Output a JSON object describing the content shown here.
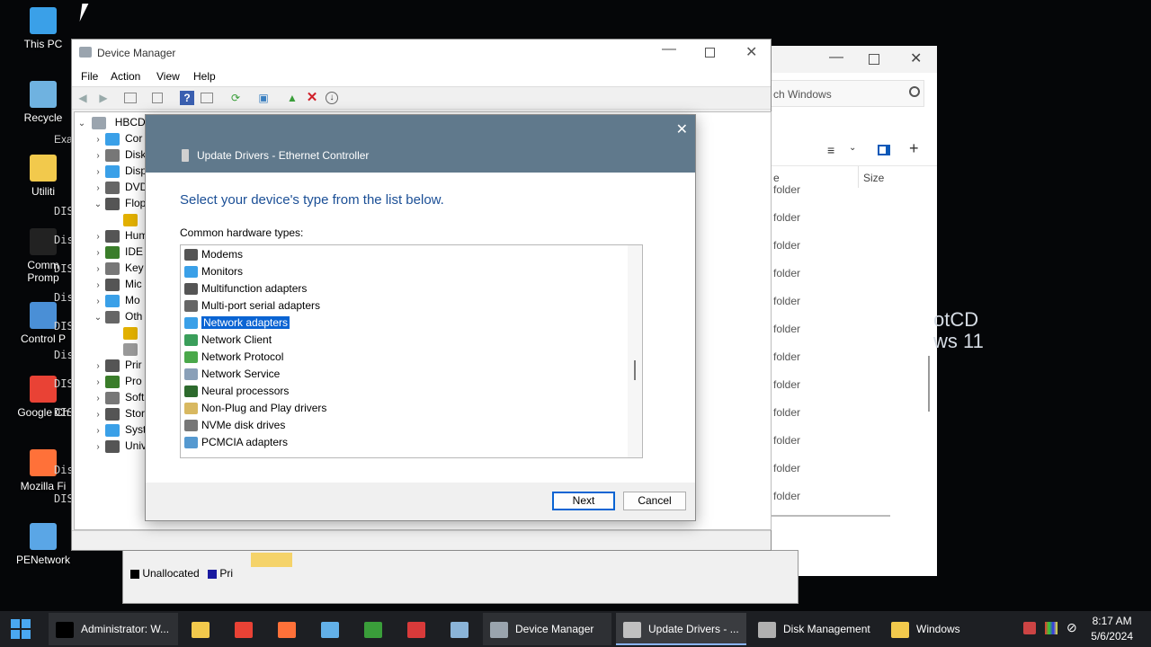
{
  "desktop": {
    "icons": [
      {
        "label": "This PC",
        "name": "this-pc",
        "color": "#3aa0e8"
      },
      {
        "label": "Recycle",
        "name": "recycle-bin",
        "color": "#6fb2e0"
      },
      {
        "label": "Utiliti",
        "name": "utilities",
        "color": "#f2c94c"
      },
      {
        "label": "Comm",
        "label2": "Promp",
        "name": "command-prompt",
        "color": "#222222"
      },
      {
        "label": "Control P",
        "name": "control-panel",
        "color": "#4a8fd6"
      },
      {
        "label": "Google Ch",
        "name": "google-chrome",
        "color": "#e94235"
      },
      {
        "label": "Mozilla Fi",
        "name": "mozilla-firefox",
        "color": "#ff7139"
      },
      {
        "label": "PENetwork",
        "name": "penetwork",
        "color": "#5aa6e6"
      }
    ],
    "partial_text_ex": "Exa",
    "dis_lines": [
      "DIS",
      "Dis",
      "DIS",
      "DIS",
      "Dis",
      "DIS",
      "Dis",
      "DIS",
      "Dis",
      "DIS"
    ],
    "background_text": [
      "otCD",
      "ws 11"
    ]
  },
  "explorer": {
    "search_placeholder": "ch Windows",
    "column_header_left": "e",
    "column_header_size": "Size",
    "rows": [
      "folder",
      "folder",
      "folder",
      "folder",
      "folder",
      "folder",
      "folder",
      "folder",
      "folder",
      "folder",
      "folder",
      "folder"
    ]
  },
  "disk_management": {
    "legend": [
      {
        "label": "Unallocated",
        "color": "#000000"
      },
      {
        "label": "Pri",
        "color": "#1a1aa0"
      }
    ]
  },
  "device_manager": {
    "title": "Device Manager",
    "menu": [
      "File",
      "Action",
      "View",
      "Help"
    ],
    "tree": {
      "root": "HBCD_",
      "items": [
        {
          "label": "Cor",
          "arrow": "›",
          "indent": 1,
          "color": "#3aa0e8"
        },
        {
          "label": "Disk",
          "arrow": "›",
          "indent": 1,
          "color": "#777777"
        },
        {
          "label": "Disp",
          "arrow": "›",
          "indent": 1,
          "color": "#3aa0e8"
        },
        {
          "label": "DVD",
          "arrow": "›",
          "indent": 1,
          "color": "#666666"
        },
        {
          "label": "Flop",
          "arrow": "⌄",
          "indent": 1,
          "color": "#555555"
        },
        {
          "label": "",
          "arrow": "",
          "indent": 2,
          "color": "#e2b000"
        },
        {
          "label": "Hum",
          "arrow": "›",
          "indent": 1,
          "color": "#555555"
        },
        {
          "label": "IDE",
          "arrow": "›",
          "indent": 1,
          "color": "#3a7d2a"
        },
        {
          "label": "Key",
          "arrow": "›",
          "indent": 1,
          "color": "#777777"
        },
        {
          "label": "Mic",
          "arrow": "›",
          "indent": 1,
          "color": "#555555"
        },
        {
          "label": "Mo",
          "arrow": "›",
          "indent": 1,
          "color": "#3aa0e8"
        },
        {
          "label": "Oth",
          "arrow": "⌄",
          "indent": 1,
          "color": "#666666"
        },
        {
          "label": "",
          "arrow": "",
          "indent": 2,
          "color": "#e2b000"
        },
        {
          "label": "",
          "arrow": "",
          "indent": 2,
          "color": "#999999"
        },
        {
          "label": "Prir",
          "arrow": "›",
          "indent": 1,
          "color": "#555555"
        },
        {
          "label": "Pro",
          "arrow": "›",
          "indent": 1,
          "color": "#3a7d2a"
        },
        {
          "label": "Soft",
          "arrow": "›",
          "indent": 1,
          "color": "#777777"
        },
        {
          "label": "Stor",
          "arrow": "›",
          "indent": 1,
          "color": "#555555"
        },
        {
          "label": "Syst",
          "arrow": "›",
          "indent": 1,
          "color": "#3aa0e8"
        },
        {
          "label": "Univ",
          "arrow": "›",
          "indent": 1,
          "color": "#555555"
        }
      ]
    }
  },
  "dialog": {
    "title": "Update Drivers - Ethernet Controller",
    "close_glyph": "✕",
    "prompt": "Select your device's type from the list below.",
    "list_label": "Common hardware types:",
    "items": [
      {
        "label": "Modems",
        "color": "#555555",
        "selected": false
      },
      {
        "label": "Monitors",
        "color": "#3aa0e8",
        "selected": false
      },
      {
        "label": "Multifunction adapters",
        "color": "#555555",
        "selected": false
      },
      {
        "label": "Multi-port serial adapters",
        "color": "#666666",
        "selected": false
      },
      {
        "label": "Network adapters",
        "color": "#3aa0e8",
        "selected": true
      },
      {
        "label": "Network Client",
        "color": "#3a9e5a",
        "selected": false
      },
      {
        "label": "Network Protocol",
        "color": "#4aa84a",
        "selected": false
      },
      {
        "label": "Network Service",
        "color": "#8aa0b8",
        "selected": false
      },
      {
        "label": "Neural processors",
        "color": "#2d6a2d",
        "selected": false
      },
      {
        "label": "Non-Plug and Play drivers",
        "color": "#d8b860",
        "selected": false
      },
      {
        "label": "NVMe disk drives",
        "color": "#777777",
        "selected": false
      },
      {
        "label": "PCMCIA adapters",
        "color": "#5599d0",
        "selected": false
      }
    ],
    "next_label": "Next",
    "cancel_label": "Cancel"
  },
  "taskbar": {
    "items": [
      {
        "label": "Administrator: W...",
        "name": "taskbar-command-prompt",
        "color": "#000000",
        "state": "open"
      },
      {
        "label": "",
        "name": "taskbar-file-explorer",
        "color": "#f2c94c",
        "state": "plain"
      },
      {
        "label": "",
        "name": "taskbar-chrome",
        "color": "#e94235",
        "state": "plain"
      },
      {
        "label": "",
        "name": "taskbar-firefox",
        "color": "#ff7139",
        "state": "plain"
      },
      {
        "label": "",
        "name": "taskbar-notepad",
        "color": "#62b0e8",
        "state": "plain"
      },
      {
        "label": "",
        "name": "taskbar-spreadsheet",
        "color": "#3a9e3a",
        "state": "plain"
      },
      {
        "label": "",
        "name": "taskbar-network-tool",
        "color": "#d83a3a",
        "state": "plain"
      },
      {
        "label": "",
        "name": "taskbar-calculator",
        "color": "#8ab4d8",
        "state": "plain"
      },
      {
        "label": "Device Manager",
        "name": "taskbar-device-manager",
        "color": "#9aa4ae",
        "state": "open"
      },
      {
        "label": "Update Drivers - ...",
        "name": "taskbar-update-drivers",
        "color": "#c0c0c0",
        "state": "active"
      },
      {
        "label": "Disk Management",
        "name": "taskbar-disk-management",
        "color": "#b0b0b0",
        "state": "plain"
      },
      {
        "label": "Windows",
        "name": "taskbar-windows-folder",
        "color": "#f2c94c",
        "state": "plain"
      }
    ],
    "time": "8:17 AM",
    "date": "5/6/2024"
  }
}
